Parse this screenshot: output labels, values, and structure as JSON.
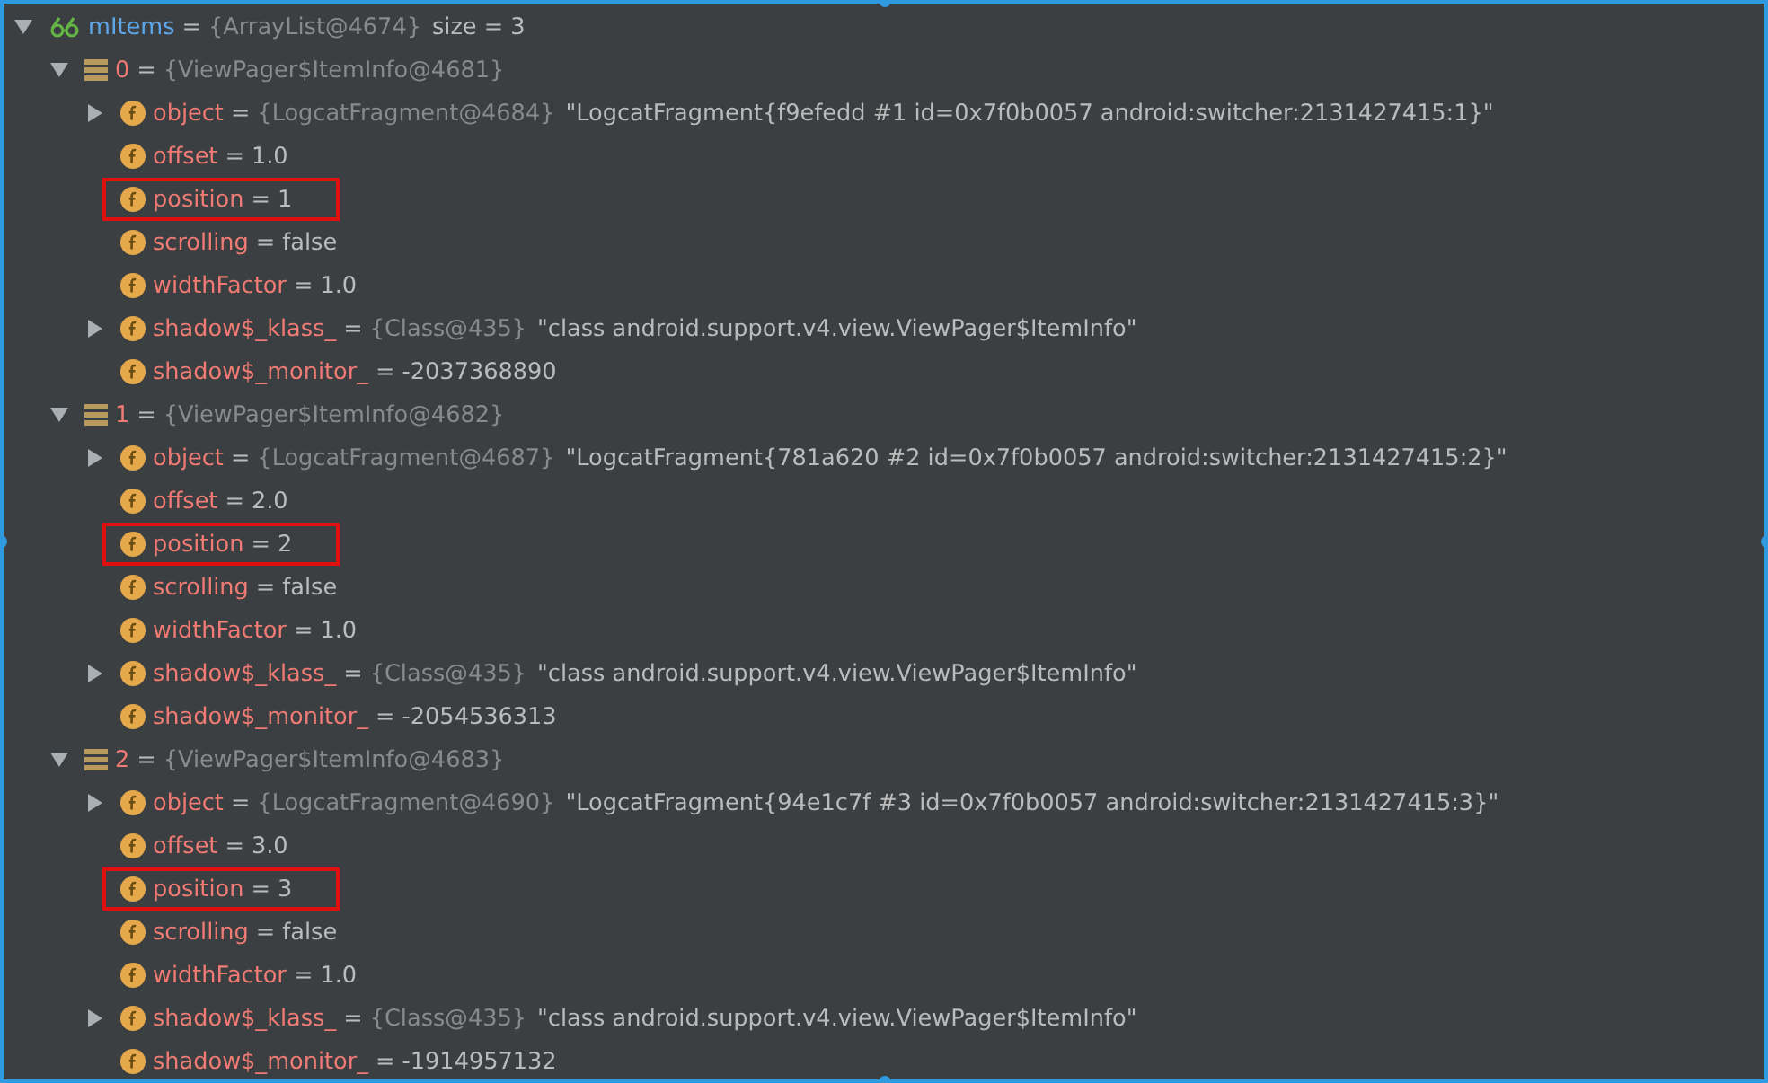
{
  "tree": {
    "kind": "watch",
    "name": "mItems",
    "eq": "=",
    "ref": "{ArrayList@4674}",
    "value": "size = 3",
    "expanded": true,
    "children": [
      {
        "kind": "array",
        "name": "0",
        "eq": "=",
        "ref": "{ViewPager$ItemInfo@4681}",
        "expanded": true,
        "children": [
          {
            "kind": "field",
            "name": "object",
            "eq": "=",
            "ref": "{LogcatFragment@4684}",
            "value": "\"LogcatFragment{f9efedd #1 id=0x7f0b0057 android:switcher:2131427415:1}\"",
            "expanded": false,
            "boxed": false
          },
          {
            "kind": "field",
            "name": "offset",
            "eq": "=",
            "value": "1.0",
            "boxed": false
          },
          {
            "kind": "field",
            "name": "position",
            "eq": "=",
            "value": "1",
            "boxed": true
          },
          {
            "kind": "field",
            "name": "scrolling",
            "eq": "=",
            "value": "false",
            "boxed": false
          },
          {
            "kind": "field",
            "name": "widthFactor",
            "eq": "=",
            "value": "1.0",
            "boxed": false
          },
          {
            "kind": "field",
            "name": "shadow$_klass_",
            "eq": "=",
            "ref": "{Class@435}",
            "value": "\"class android.support.v4.view.ViewPager$ItemInfo\"",
            "expanded": false,
            "boxed": false
          },
          {
            "kind": "field",
            "name": "shadow$_monitor_",
            "eq": "=",
            "value": "-2037368890",
            "boxed": false
          }
        ]
      },
      {
        "kind": "array",
        "name": "1",
        "eq": "=",
        "ref": "{ViewPager$ItemInfo@4682}",
        "expanded": true,
        "children": [
          {
            "kind": "field",
            "name": "object",
            "eq": "=",
            "ref": "{LogcatFragment@4687}",
            "value": "\"LogcatFragment{781a620 #2 id=0x7f0b0057 android:switcher:2131427415:2}\"",
            "expanded": false,
            "boxed": false
          },
          {
            "kind": "field",
            "name": "offset",
            "eq": "=",
            "value": "2.0",
            "boxed": false
          },
          {
            "kind": "field",
            "name": "position",
            "eq": "=",
            "value": "2",
            "boxed": true
          },
          {
            "kind": "field",
            "name": "scrolling",
            "eq": "=",
            "value": "false",
            "boxed": false
          },
          {
            "kind": "field",
            "name": "widthFactor",
            "eq": "=",
            "value": "1.0",
            "boxed": false
          },
          {
            "kind": "field",
            "name": "shadow$_klass_",
            "eq": "=",
            "ref": "{Class@435}",
            "value": "\"class android.support.v4.view.ViewPager$ItemInfo\"",
            "expanded": false,
            "boxed": false
          },
          {
            "kind": "field",
            "name": "shadow$_monitor_",
            "eq": "=",
            "value": "-2054536313",
            "boxed": false
          }
        ]
      },
      {
        "kind": "array",
        "name": "2",
        "eq": "=",
        "ref": "{ViewPager$ItemInfo@4683}",
        "expanded": true,
        "children": [
          {
            "kind": "field",
            "name": "object",
            "eq": "=",
            "ref": "{LogcatFragment@4690}",
            "value": "\"LogcatFragment{94e1c7f #3 id=0x7f0b0057 android:switcher:2131427415:3}\"",
            "expanded": false,
            "boxed": false
          },
          {
            "kind": "field",
            "name": "offset",
            "eq": "=",
            "value": "3.0",
            "boxed": false
          },
          {
            "kind": "field",
            "name": "position",
            "eq": "=",
            "value": "3",
            "boxed": true
          },
          {
            "kind": "field",
            "name": "scrolling",
            "eq": "=",
            "value": "false",
            "boxed": false
          },
          {
            "kind": "field",
            "name": "widthFactor",
            "eq": "=",
            "value": "1.0",
            "boxed": false
          },
          {
            "kind": "field",
            "name": "shadow$_klass_",
            "eq": "=",
            "ref": "{Class@435}",
            "value": "\"class android.support.v4.view.ViewPager$ItemInfo\"",
            "expanded": false,
            "boxed": false
          },
          {
            "kind": "field",
            "name": "shadow$_monitor_",
            "eq": "=",
            "value": "-1914957132",
            "boxed": false
          }
        ]
      }
    ]
  }
}
